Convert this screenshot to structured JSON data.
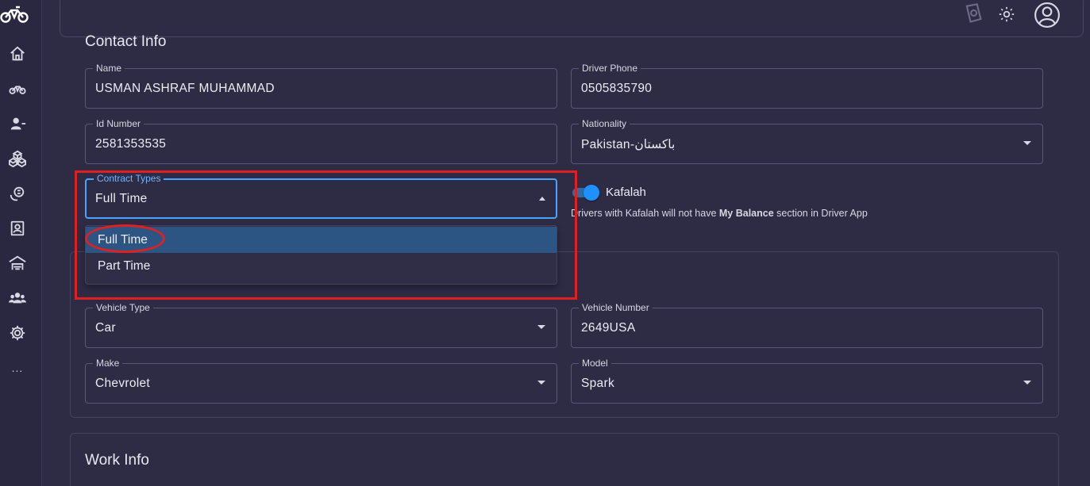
{
  "sidebar": {
    "items": [
      {
        "icon": "motorcycle-logo-icon"
      },
      {
        "icon": "home-icon"
      },
      {
        "icon": "motorcycle-icon"
      },
      {
        "icon": "user-add-icon"
      },
      {
        "icon": "boxes-icon"
      },
      {
        "icon": "coin-hand-icon"
      },
      {
        "icon": "book-user-icon"
      },
      {
        "icon": "garage-icon"
      },
      {
        "icon": "team-icon"
      },
      {
        "icon": "gear-icon"
      }
    ],
    "more": "..."
  },
  "topbar": {
    "icons": [
      "money-icon",
      "sun-icon",
      "account-avatar-icon"
    ]
  },
  "contact_info": {
    "title": "Contact Info",
    "name": {
      "label": "Name",
      "value": "USMAN ASHRAF MUHAMMAD"
    },
    "driver_phone": {
      "label": "Driver Phone",
      "value": "0505835790"
    },
    "id_number": {
      "label": "Id Number",
      "value": "2581353535"
    },
    "nationality": {
      "label": "Nationality",
      "value": "Pakistan-باكستان"
    },
    "contract_types": {
      "label": "Contract Types",
      "value": "Full Time",
      "options": [
        "Full Time",
        "Part Time"
      ],
      "selected_index": 0
    },
    "kafalah": {
      "label": "Kafalah",
      "enabled": true,
      "help_prefix": "Drivers with Kafalah will not have ",
      "help_bold": "My Balance",
      "help_suffix": " section in Driver App"
    }
  },
  "vehicle": {
    "vehicle_type": {
      "label": "Vehicle Type",
      "value": "Car"
    },
    "vehicle_number": {
      "label": "Vehicle Number",
      "value": "2649USA"
    },
    "make": {
      "label": "Make",
      "value": "Chevrolet"
    },
    "model": {
      "label": "Model",
      "value": "Spark"
    }
  },
  "work_info": {
    "title": "Work Info"
  },
  "colors": {
    "accent": "#4aa3ff",
    "selected_option": "#2d5583",
    "annotation": "#e02020",
    "background": "#2e2b45"
  }
}
